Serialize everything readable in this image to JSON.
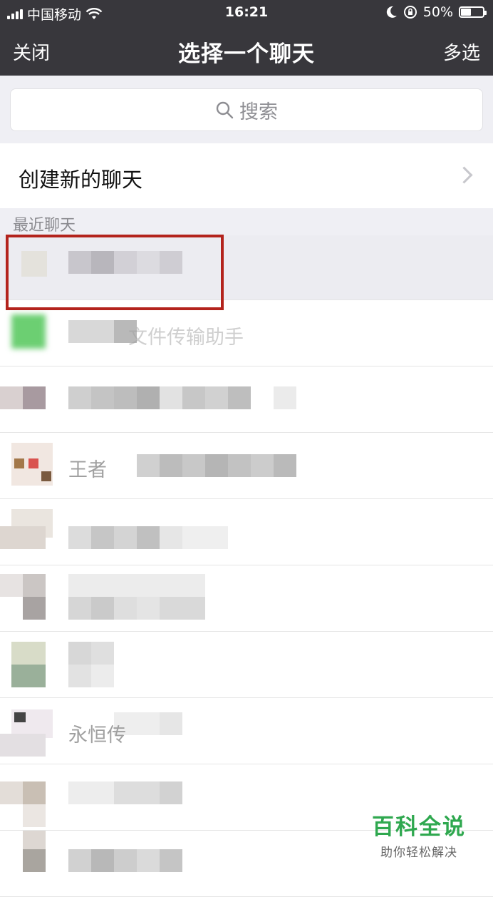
{
  "status_bar": {
    "carrier": "中国移动",
    "time": "16:21",
    "battery_percent": "50%",
    "battery_level": 0.5
  },
  "nav": {
    "close_label": "关闭",
    "title": "选择一个聊天",
    "multi_select_label": "多选"
  },
  "search": {
    "placeholder": "搜索"
  },
  "new_chat": {
    "label": "创建新的聊天"
  },
  "section_label": "最近聊天",
  "chats": [
    {
      "name": ""
    },
    {
      "name": "文件传输助手"
    },
    {
      "name": ""
    },
    {
      "name": "王者"
    },
    {
      "name": ""
    },
    {
      "name": ""
    },
    {
      "name": ""
    },
    {
      "name": "永恒传"
    },
    {
      "name": ""
    },
    {
      "name": ""
    }
  ],
  "watermark": {
    "title": "百科全说",
    "subtitle": "助你轻松解决"
  },
  "colors": {
    "nav_bg": "#38373c",
    "highlight": "#b3231c",
    "watermark_green": "#2fa84f"
  }
}
